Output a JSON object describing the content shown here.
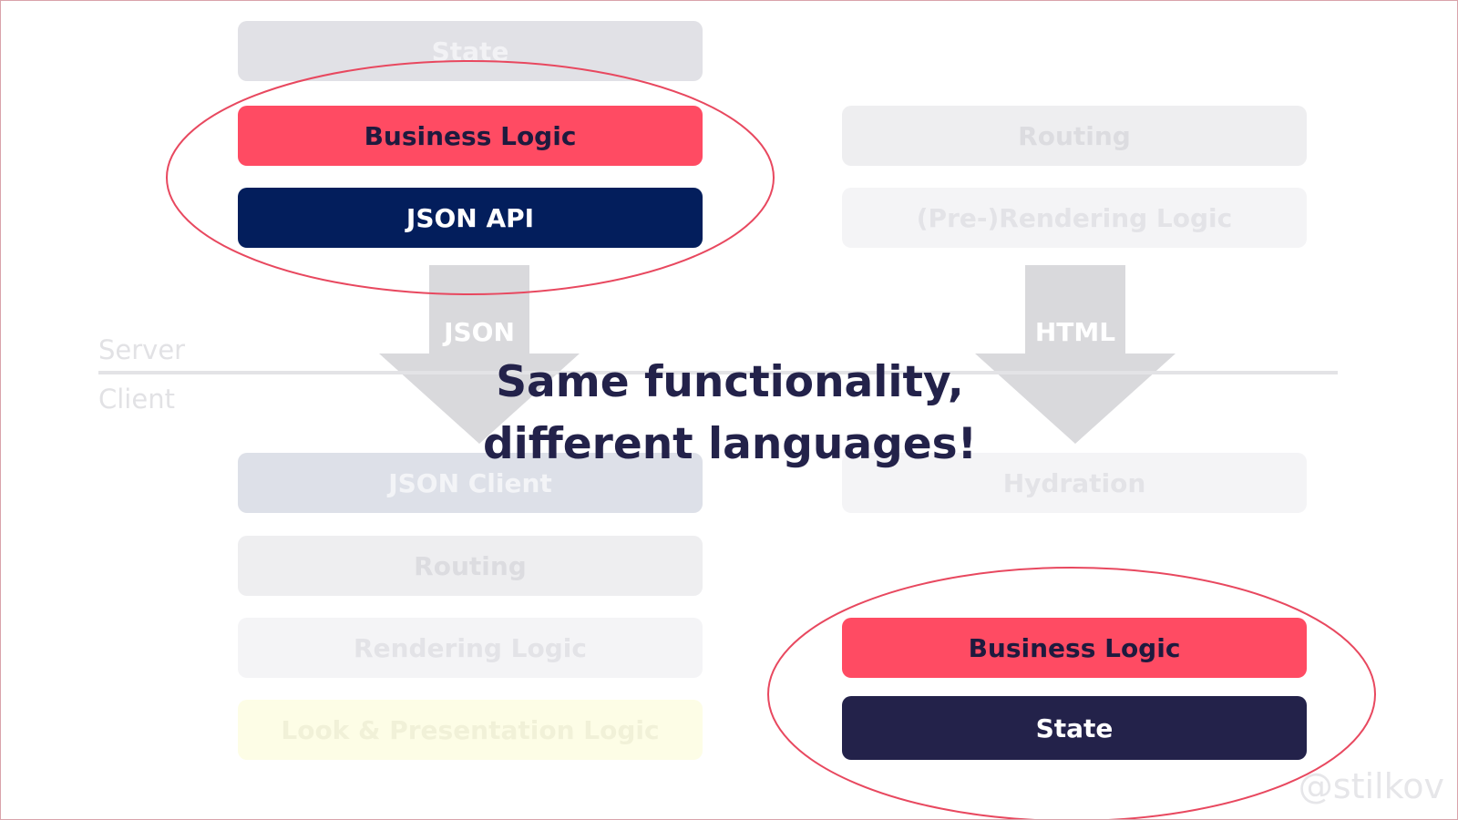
{
  "left_stack": {
    "state": "State",
    "business_logic": "Business Logic",
    "json_api": "JSON API",
    "json_client": "JSON Client",
    "routing": "Routing",
    "rendering_logic": "Rendering Logic",
    "look_presentation": "Look & Presentation Logic"
  },
  "right_stack": {
    "routing": "Routing",
    "prerendering_logic": "(Pre-)Rendering Logic",
    "hydration": "Hydration",
    "business_logic": "Business Logic",
    "state": "State"
  },
  "arrows": {
    "left_label": "JSON",
    "right_label": "HTML"
  },
  "tiers": {
    "server": "Server",
    "client": "Client"
  },
  "headline": {
    "line1": "Same functionality,",
    "line2": "different languages!"
  },
  "handle": "@stilkov",
  "colors": {
    "accent_red": "#ff4b63",
    "navy": "#031e5c",
    "dark_navy": "#23224a",
    "ellipse_stroke": "#e8485f"
  }
}
